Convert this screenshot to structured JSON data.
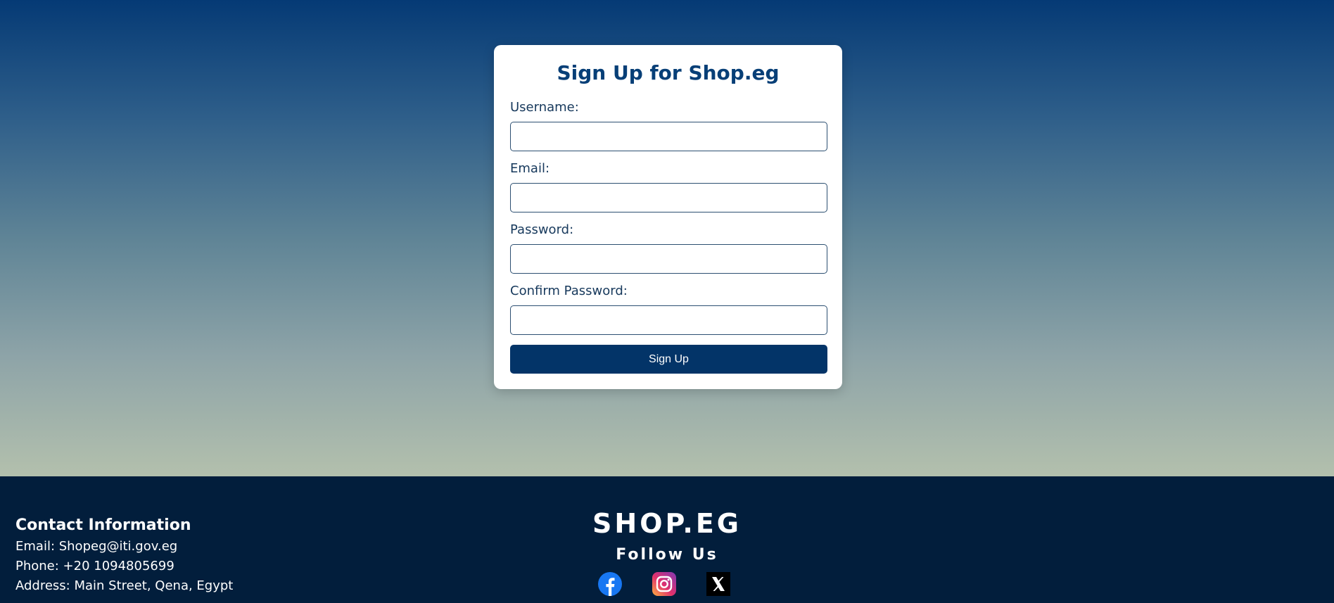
{
  "signup": {
    "title": "Sign Up for Shop.eg",
    "fields": {
      "username": {
        "label": "Username:",
        "value": ""
      },
      "email": {
        "label": "Email:",
        "value": ""
      },
      "password": {
        "label": "Password:",
        "value": ""
      },
      "confirm": {
        "label": "Confirm Password:",
        "value": ""
      }
    },
    "submit_label": "Sign Up"
  },
  "footer": {
    "contact": {
      "heading": "Contact Information",
      "email": "Email: Shopeg@iti.gov.eg",
      "phone": "Phone: +20 1094805699",
      "address": "Address: Main Street, Qena, Egypt"
    },
    "brand": "SHOP.EG",
    "follow": "Follow Us",
    "socials": [
      {
        "icon": "facebook-icon"
      },
      {
        "icon": "instagram-icon"
      },
      {
        "icon": "x-icon"
      }
    ]
  },
  "colors": {
    "primary": "#033468",
    "title": "#073f77",
    "footer_bg": "#021e3c",
    "gradient_top": "#053a75",
    "gradient_bottom": "#b3c0ad"
  }
}
